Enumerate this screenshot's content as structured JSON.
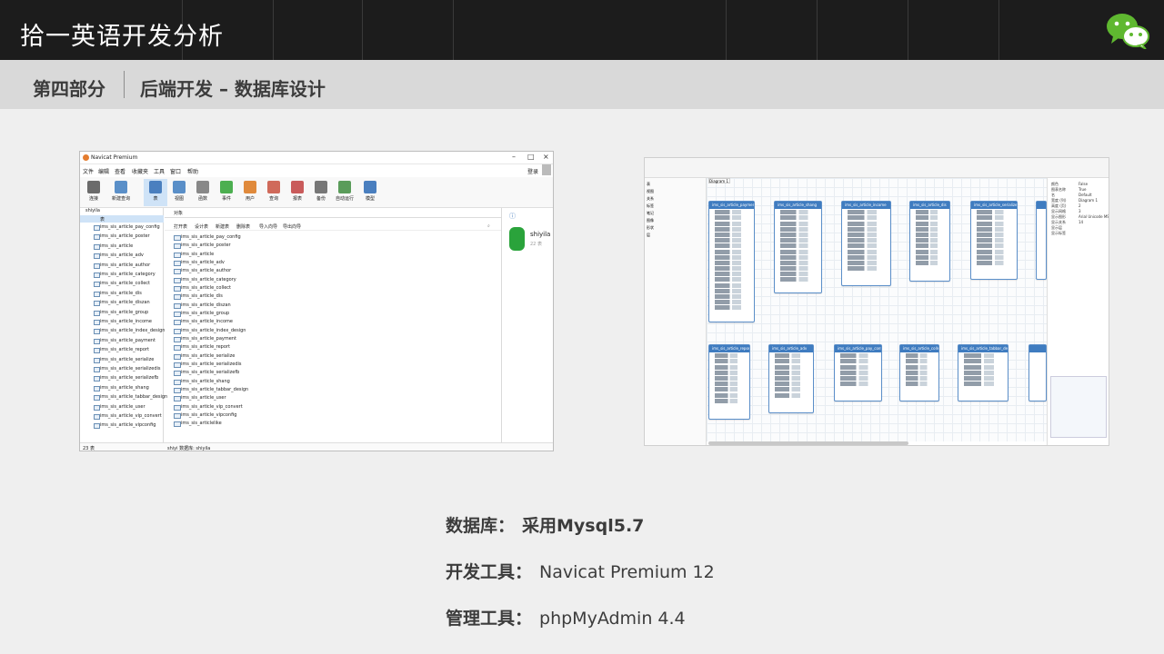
{
  "header": {
    "title": "拾一英语开发分析"
  },
  "section": {
    "part": "第四部分",
    "title": "后端开发 – 数据库设计"
  },
  "navicat": {
    "window_title": "Navicat Premium",
    "menu": [
      "文件",
      "编辑",
      "查看",
      "收藏夹",
      "工具",
      "窗口",
      "帮助"
    ],
    "login": "登录",
    "toolbar": [
      "连接",
      "新建查询",
      "表",
      "视图",
      "函数",
      "事件",
      "用户",
      "查询",
      "报表",
      "备份",
      "自动运行",
      "模型"
    ],
    "connection": "shiyila",
    "tree_group": "表",
    "tables": [
      "ims_sis_article_pay_config",
      "ims_sis_article_poster",
      "ims_sis_article",
      "ims_sis_article_adv",
      "ims_sis_article_author",
      "ims_sis_article_category",
      "ims_sis_article_collect",
      "ims_sis_article_dis",
      "ims_sis_article_diszan",
      "ims_sis_article_group",
      "ims_sis_article_income",
      "ims_sis_article_index_design",
      "ims_sis_article_payment",
      "ims_sis_article_report",
      "ims_sis_article_serialize",
      "ims_sis_article_serializedis",
      "ims_sis_article_serializefb",
      "ims_sis_article_shang",
      "ims_sis_article_tabbar_design",
      "ims_sis_article_user",
      "ims_sis_article_vip_convert",
      "ims_sis_article_vipconfig",
      "ims_sis_articlelike"
    ],
    "objects_tab": "对象",
    "actions": [
      "打开表",
      "设计表",
      "新建表",
      "删除表",
      "导入向导",
      "导出向导"
    ],
    "db_name": "shiyila",
    "db_count": "22 表",
    "status_left": "23 表",
    "status_mid": "shiyi   数据库: shiyila"
  },
  "er": {
    "tab": "Diagram 1",
    "entities_row1": [
      "ims_sis_article_payment",
      "ims_sis_article_shang",
      "ims_sis_article_income",
      "ims_sis_article_dis",
      "ims_sis_article_serializedis"
    ],
    "entities_row2": [
      "ims_sis_article_report",
      "ims_sis_article_adv",
      "ims_sis_article_pay_config",
      "ims_sis_article_collect",
      "ims_sis_article_tabbar_design"
    ],
    "left_items": [
      "表",
      "视图",
      "关系",
      "标签",
      "笔记",
      "图像",
      "形状",
      "层"
    ],
    "right_items": [
      "颜色",
      "图表名称",
      "名",
      "宽度 (列)",
      "高度 (页)",
      "显示网格",
      "显示图形",
      "显示关系",
      "显示层",
      "显示标签",
      "False",
      "True",
      "Default",
      "Diagram 1",
      "2",
      "3",
      "Arial Unicode MS",
      "14"
    ]
  },
  "info": [
    {
      "key": "数据库：",
      "value": "采用Mysql5.7"
    },
    {
      "key": "开发工具：",
      "value": "Navicat Premium 12"
    },
    {
      "key": "管理工具：",
      "value": "phpMyAdmin 4.4"
    }
  ],
  "colors": {
    "topbar": "#1c1c1c",
    "section_bar": "#d9d9d9",
    "entity_header": "#3f7cc0",
    "wechat": "#5fb830"
  }
}
